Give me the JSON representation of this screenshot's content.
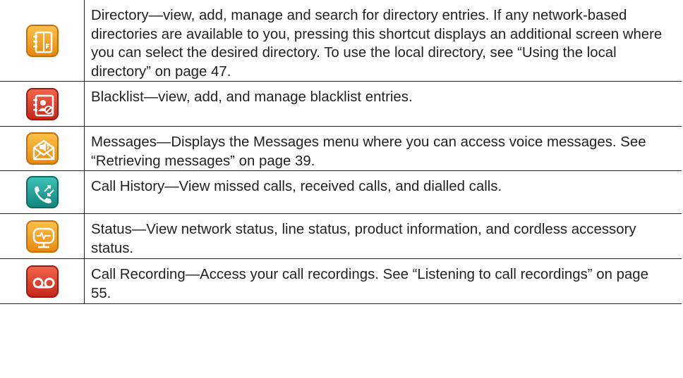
{
  "rows": [
    {
      "icon": "directory-icon",
      "color": "#f5a21a",
      "text": "Directory—view, add, manage and search for directory entries. If any network-based directories are available to you, pressing this shortcut displays an additional screen where you can select the desired directory. To use the local directory, see “Using the local directory” on page 47."
    },
    {
      "icon": "blacklist-icon",
      "color": "#e23b2a",
      "text": "Blacklist—view, add, and manage blacklist entries."
    },
    {
      "icon": "messages-icon",
      "color": "#f5a21a",
      "text": "Messages—Displays the Messages menu where you can access voice messages. See “Retrieving messages” on page 39."
    },
    {
      "icon": "call-history-icon",
      "color": "#1fa39a",
      "text": "Call History—View missed calls, received calls, and dialled calls."
    },
    {
      "icon": "status-icon",
      "color": "#f5a21a",
      "text": "Status—View network status, line status, product information, and cordless accessory status."
    },
    {
      "icon": "call-recording-icon",
      "color": "#e23b2a",
      "text": "Call Recording—Access your call recordings. See “Listening to call recordings” on page 55."
    }
  ]
}
